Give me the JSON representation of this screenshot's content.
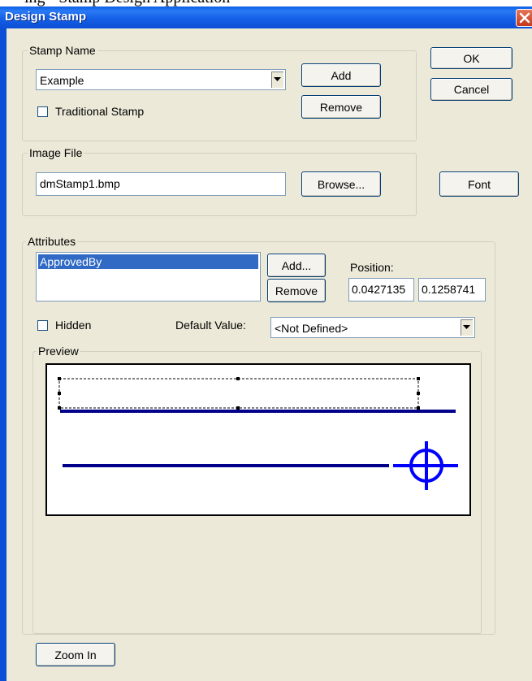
{
  "background_caption": "ing - Stamp Design Application",
  "window": {
    "title": "Design Stamp"
  },
  "stamp_name": {
    "group_label": "Stamp Name",
    "selected": "Example",
    "add_label": "Add",
    "remove_label": "Remove",
    "traditional_label": "Traditional Stamp",
    "traditional_checked": false
  },
  "image_file": {
    "group_label": "Image File",
    "value": "dmStamp1.bmp",
    "browse_label": "Browse..."
  },
  "buttons": {
    "ok": "OK",
    "cancel": "Cancel",
    "font": "Font",
    "zoom_in": "Zoom In"
  },
  "attributes": {
    "group_label": "Attributes",
    "items": [
      "ApprovedBy"
    ],
    "selected_index": 0,
    "add_label": "Add...",
    "remove_label": "Remove",
    "position_label": "Position:",
    "position_x": "0.0427135",
    "position_y": "0.1258741",
    "hidden_label": "Hidden",
    "hidden_checked": false,
    "default_value_label": "Default Value:",
    "default_value": "<Not Defined>"
  },
  "preview": {
    "group_label": "Preview"
  },
  "colors": {
    "title_blue": "#0b4fd6",
    "stamp_line": "#00008b",
    "crosshair": "#0000ff",
    "selection": "#316ac5"
  }
}
